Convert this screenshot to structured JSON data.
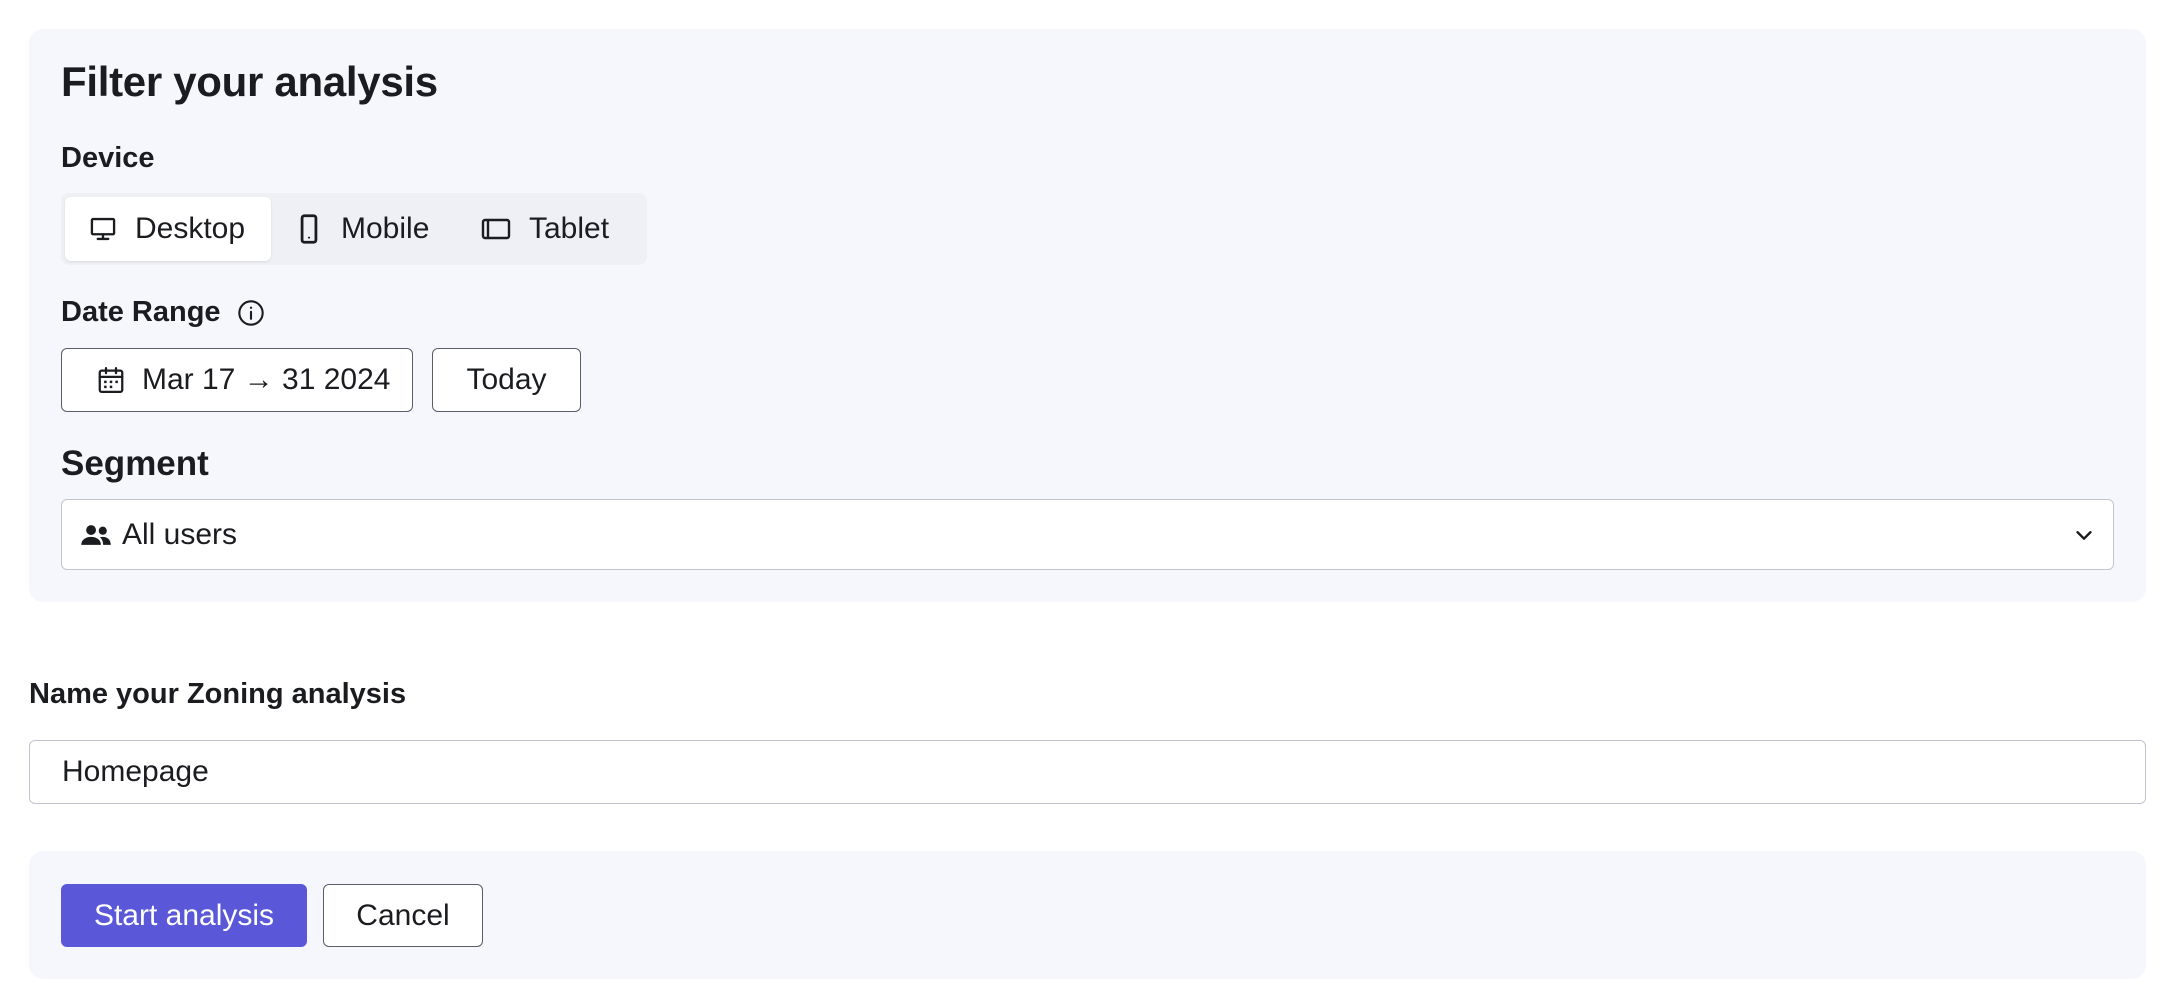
{
  "filter": {
    "title": "Filter your analysis",
    "device": {
      "label": "Device",
      "options": [
        {
          "label": "Desktop",
          "icon": "monitor-icon",
          "selected": true
        },
        {
          "label": "Mobile",
          "icon": "smartphone-icon",
          "selected": false
        },
        {
          "label": "Tablet",
          "icon": "tablet-icon",
          "selected": false
        }
      ]
    },
    "date_range": {
      "label": "Date Range",
      "info_icon": "info-icon",
      "value": "Mar 17 → 31 2024",
      "calendar_icon": "calendar-icon",
      "today_label": "Today"
    },
    "segment": {
      "label": "Segment",
      "value": "All users",
      "icon": "users-icon",
      "dropdown_icon": "chevron-down-icon"
    }
  },
  "name_section": {
    "label": "Name your Zoning analysis",
    "value": "Homepage"
  },
  "actions": {
    "start_label": "Start analysis",
    "cancel_label": "Cancel"
  },
  "colors": {
    "panel_bg": "#f6f7fc",
    "primary": "#5a57d8",
    "text": "#1b1c20",
    "border": "#c2c5cf"
  }
}
